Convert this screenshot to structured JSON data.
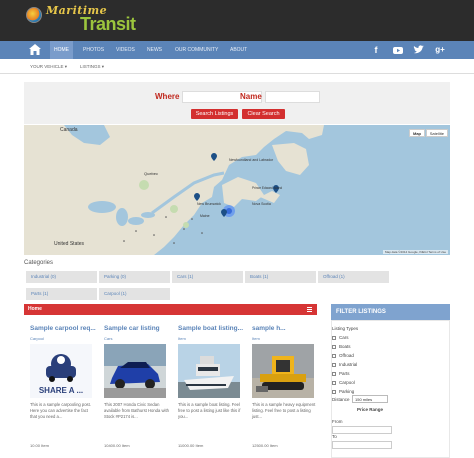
{
  "brand": {
    "line1": "Maritime",
    "line2": "Transit"
  },
  "nav": {
    "items": [
      "HOME",
      "PHOTOS",
      "VIDEOS",
      "NEWS",
      "OUR COMMUNITY",
      "ABOUT"
    ],
    "social": [
      "facebook-icon",
      "youtube-icon",
      "twitter-icon",
      "google-plus-icon"
    ]
  },
  "subnav": {
    "items": [
      "YOUR VEHICLE ▾",
      "LISTINGS ▾"
    ]
  },
  "search": {
    "where_label": "Where",
    "name_label": "Name",
    "search_btn": "Search Listings",
    "clear_btn": "Clear Search"
  },
  "map": {
    "ctl_map": "Map",
    "ctl_sat": "Satellite",
    "credit": "Map data ©2014 Google, INEGI   Terms of Use",
    "labels": {
      "canada": "Canada",
      "newfoundland": "Newfoundland and Labrador",
      "quebec": "Quebec",
      "maine": "Maine",
      "new_brunswick": "New Brunswick",
      "nova_scotia": "Nova Scotia",
      "pei": "Prince Edward Island",
      "us": "United States"
    }
  },
  "categories": {
    "title": "Categories",
    "items": [
      "Industrial (0)",
      "Parking (0)",
      "Cars (1)",
      "Boats (1)",
      "Offroad (1)",
      "Parts (1)",
      "Carpool (1)"
    ]
  },
  "home_bar": {
    "label": "Home"
  },
  "cards": [
    {
      "title": "Sample carpool req...",
      "category": "Carpool",
      "desc": "This is a sample carpooling post. Here you can advertise the fact that you need a...",
      "price": "10.00 Item"
    },
    {
      "title": "Sample car listing",
      "category": "Cars",
      "desc": "This 2007 Honda Civic Sedan available from Bathurst Honda with Stock #P2174 is...",
      "price": "10400.00 Item"
    },
    {
      "title": "Sample boat listing...",
      "category": "Item",
      "desc": "This is a sample boat listing. Feel free to post a listing just like this if you...",
      "price": "11000.00 Item"
    },
    {
      "title": "sample h...",
      "category": "Item",
      "desc": "This is a sample heavy equipment listing. Feel free to post a listing just...",
      "price": "12500.00 Item"
    }
  ],
  "filter": {
    "title": "FILTER LISTINGS",
    "types_label": "Listing Types",
    "types": [
      "Cars",
      "Boats",
      "Offroad",
      "Industrial",
      "Parts",
      "Carpool",
      "Parking"
    ],
    "distance_label": "Distance",
    "distance_value": "150 miles",
    "price_label": "Price Range",
    "from_label": "From",
    "to_label": "To"
  },
  "colors": {
    "nav": "#5b84b8",
    "header": "#2c2c2c",
    "accent_red": "#d63535",
    "link": "#5b84b8"
  }
}
